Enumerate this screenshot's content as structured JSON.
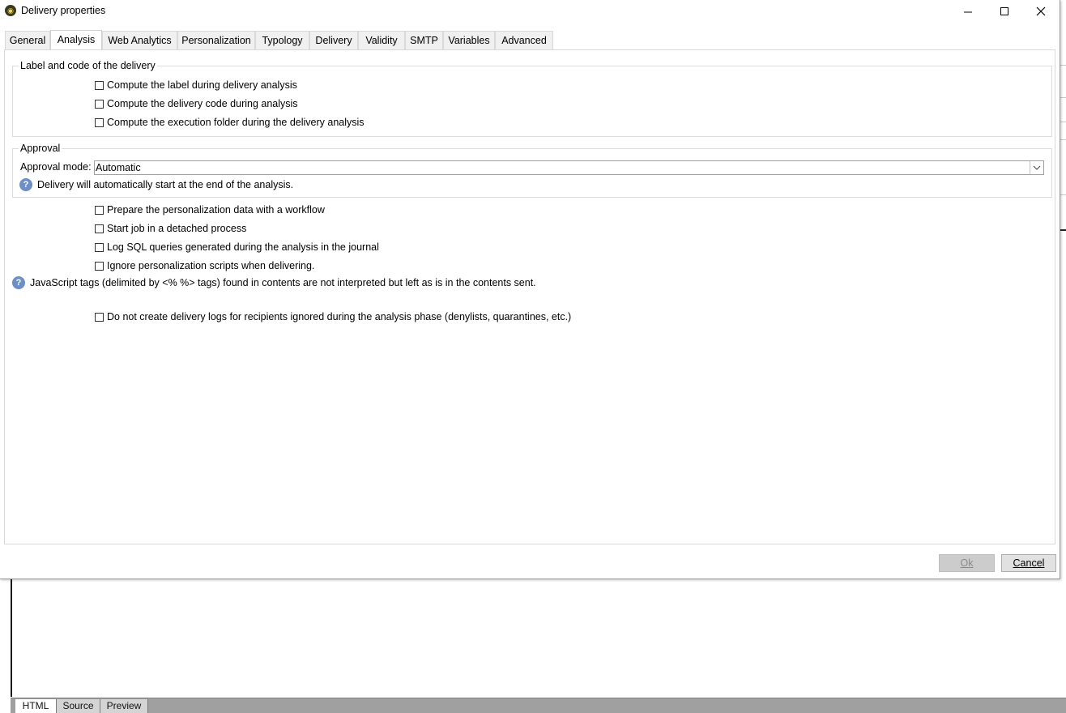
{
  "window": {
    "title": "Delivery properties",
    "icon": "app-logo-icon"
  },
  "tabs": [
    {
      "label": "General"
    },
    {
      "label": "Analysis",
      "active": true
    },
    {
      "label": "Web Analytics"
    },
    {
      "label": "Personalization"
    },
    {
      "label": "Typology"
    },
    {
      "label": "Delivery"
    },
    {
      "label": "Validity"
    },
    {
      "label": "SMTP"
    },
    {
      "label": "Variables"
    },
    {
      "label": "Advanced"
    }
  ],
  "label_group": {
    "legend": "Label and code of the delivery",
    "options": [
      {
        "label": "Compute the label during delivery analysis",
        "checked": false
      },
      {
        "label": "Compute the delivery code during analysis",
        "checked": false
      },
      {
        "label": "Compute the execution folder during the delivery analysis",
        "checked": false
      }
    ]
  },
  "approval_group": {
    "legend": "Approval",
    "mode_label": "Approval mode:",
    "mode_value": "Automatic",
    "info": "Delivery will automatically start at the end of the analysis."
  },
  "options": [
    {
      "label": "Prepare the personalization data with a workflow",
      "checked": false
    },
    {
      "label": "Start job in a detached process",
      "checked": false
    },
    {
      "label": "Log SQL queries generated during the analysis in the journal",
      "checked": false
    },
    {
      "label": "Ignore personalization scripts when delivering.",
      "checked": false
    }
  ],
  "js_info": "JavaScript tags (delimited by <% %> tags) found in contents are not interpreted but left as is in the contents sent.",
  "no_logs_option": {
    "label": "Do not create delivery logs for recipients ignored during the analysis phase (denylists, quarantines, etc.)",
    "checked": false
  },
  "footer": {
    "ok_label": "Ok",
    "ok_enabled": false,
    "cancel_label": "Cancel"
  },
  "bottom_tabs": [
    {
      "label": "HTML",
      "active": true
    },
    {
      "label": "Source"
    },
    {
      "label": "Preview"
    }
  ],
  "colors": {
    "info_icon": "#6d8fc6",
    "tab_inactive_bg": "#f0f0f0",
    "ok_disabled_bg": "#cccccc"
  }
}
